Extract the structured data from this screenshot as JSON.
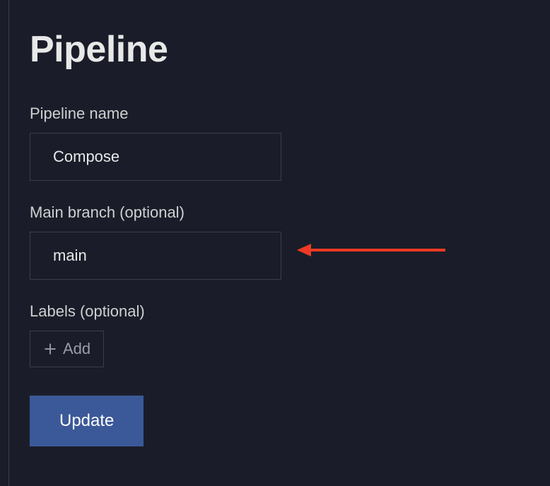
{
  "page": {
    "title": "Pipeline"
  },
  "form": {
    "pipeline_name": {
      "label": "Pipeline name",
      "value": "Compose"
    },
    "main_branch": {
      "label": "Main branch (optional)",
      "value": "main"
    },
    "labels": {
      "label": "Labels (optional)",
      "add_button": "Add"
    },
    "submit": {
      "label": "Update"
    }
  },
  "colors": {
    "background": "#1a1d29",
    "border": "#3a3d4a",
    "text": "#e8e8e8",
    "muted": "#9a9da8",
    "primary": "#3b5998",
    "annotation": "#ee3a24"
  }
}
